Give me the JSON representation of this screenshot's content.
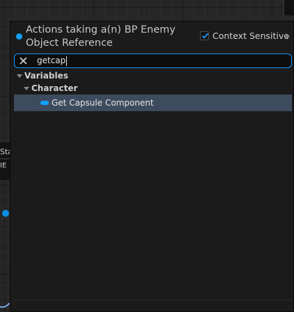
{
  "background": {
    "node_text_1": "Sta",
    "node_text_2": "IE"
  },
  "menu": {
    "title": "Actions taking a(n) BP Enemy Object Reference",
    "context_sensitive": {
      "label": "Context Sensitive",
      "checked": true
    },
    "search": {
      "value": "getcap",
      "clear_icon": "close-icon"
    },
    "tree": {
      "category": "Variables",
      "subcategory": "Character",
      "items": [
        {
          "label": "Get Capsule Component",
          "selected": true
        }
      ]
    }
  },
  "colors": {
    "accent": "#12a0ff",
    "selection": "#3d4b5e",
    "panel_bg": "#1b1b1b"
  }
}
